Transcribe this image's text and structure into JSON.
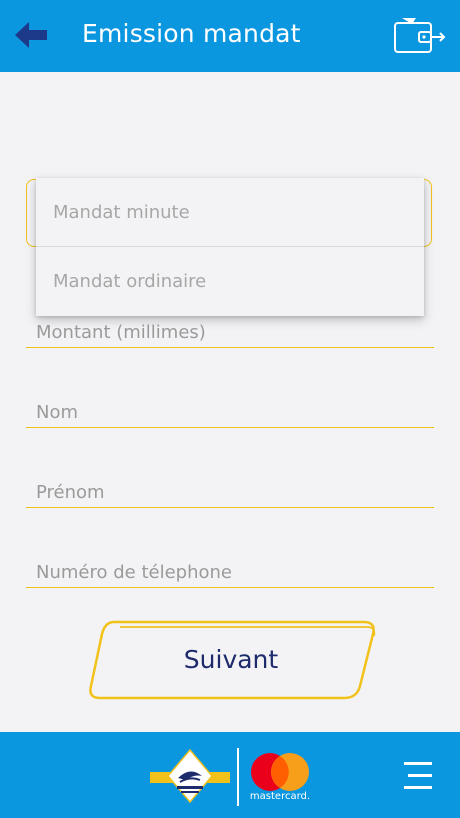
{
  "header": {
    "title": "Emission mandat",
    "back_icon": "arrow-left-icon",
    "wallet_icon": "wallet-exit-icon"
  },
  "mandat_type": {
    "options": [
      "Mandat minute",
      "Mandat ordinaire"
    ]
  },
  "form": {
    "montant_placeholder": "Montant (millimes)",
    "nom_placeholder": "Nom",
    "prenom_placeholder": "Prénom",
    "telephone_placeholder": "Numéro de télephone"
  },
  "submit": {
    "label": "Suivant"
  },
  "footer": {
    "mastercard_text": "mastercard.",
    "menu_icon": "hamburger-menu-icon"
  },
  "colors": {
    "primary": "#0b97e0",
    "accent": "#f2c21b",
    "button_text": "#1d2a6b",
    "background": "#f3f3f5"
  }
}
